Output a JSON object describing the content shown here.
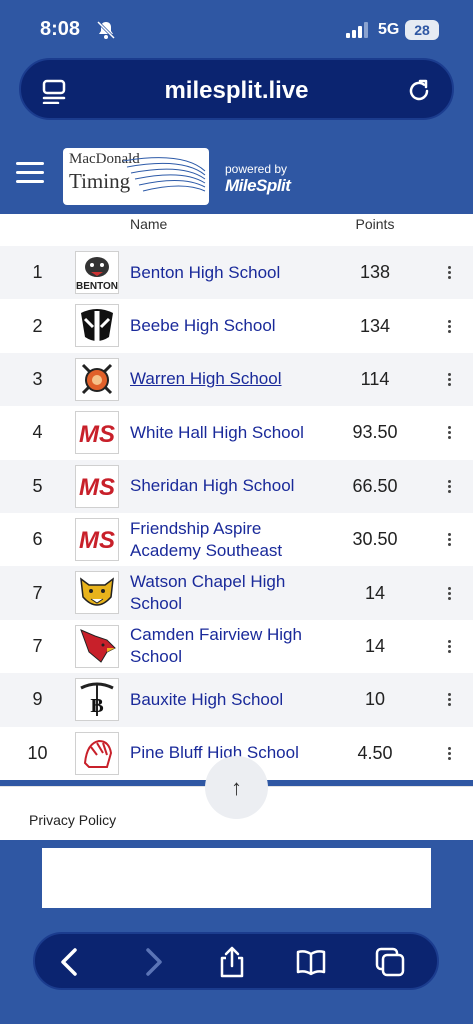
{
  "status": {
    "time": "8:08",
    "network": "5G",
    "battery": "28"
  },
  "browser": {
    "url": "milesplit.live"
  },
  "header": {
    "logo_line1": "MacDonald",
    "logo_line2": "Timing",
    "powered_by": "powered by",
    "brand": "MileSplit"
  },
  "table": {
    "col_name": "Name",
    "col_points": "Points",
    "rows": [
      {
        "rank": "1",
        "school": "Benton High School",
        "points": "138",
        "badge": "panther"
      },
      {
        "rank": "2",
        "school": "Beebe High School",
        "points": "134",
        "badge": "badger"
      },
      {
        "rank": "3",
        "school": "Warren High School",
        "points": "114",
        "badge": "lumberjack"
      },
      {
        "rank": "4",
        "school": "White Hall High School",
        "points": "93.50",
        "badge": "ms-logo"
      },
      {
        "rank": "5",
        "school": "Sheridan High School",
        "points": "66.50",
        "badge": "ms-logo"
      },
      {
        "rank": "6",
        "school": "Friendship Aspire Academy Southeast",
        "points": "30.50",
        "badge": "ms-logo"
      },
      {
        "rank": "7",
        "school": "Watson Chapel High School",
        "points": "14",
        "badge": "wildcat"
      },
      {
        "rank": "7",
        "school": "Camden Fairview High School",
        "points": "14",
        "badge": "cardinal"
      },
      {
        "rank": "9",
        "school": "Bauxite High School",
        "points": "10",
        "badge": "miner"
      },
      {
        "rank": "10",
        "school": "Pine Bluff High School",
        "points": "4.50",
        "badge": "zebra"
      }
    ],
    "badge_text": {
      "benton": "BENTON",
      "ms": "MS",
      "bauxite": "B"
    }
  },
  "footer": {
    "privacy": "Privacy Policy",
    "scroll_top": "↑"
  },
  "colors": {
    "background": "#2f57a3",
    "bar": "#0b2470",
    "link": "#1a2a9a",
    "ms_red": "#c8202a"
  }
}
